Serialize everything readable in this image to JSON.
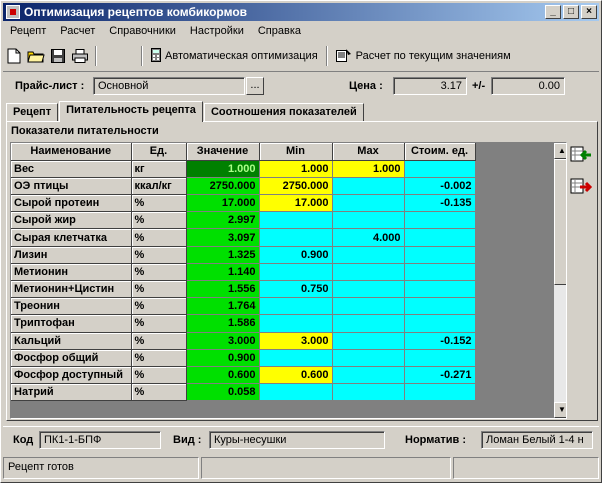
{
  "window": {
    "title": "Оптимизация рецептов комбикормов",
    "controls": {
      "minimize": "_",
      "maximize": "□",
      "close": "×"
    }
  },
  "menu": [
    "Рецепт",
    "Расчет",
    "Справочники",
    "Настройки",
    "Справка"
  ],
  "toolbar": {
    "auto_opt": "Автоматическая оптимизация",
    "calc_current": "Расчет по текущим значениям"
  },
  "price_bar": {
    "price_list_label": "Прайс-лист :",
    "price_list_value": "Основной",
    "browse_label": "...",
    "price_label": "Цена :",
    "price_value": "3.17",
    "plusminus_label": "+/-",
    "plusminus_value": "0.00"
  },
  "tabs": [
    "Рецепт",
    "Питательность рецепта",
    "Соотношения показателей"
  ],
  "active_tab": 1,
  "panel_title": "Показатели питательности",
  "grid": {
    "columns": [
      "Наименование",
      "Ед.",
      "Значение",
      "Min",
      "Max",
      "Стоим. ед."
    ],
    "rows": [
      {
        "name": "Вес",
        "unit": "кг",
        "value": "1.000",
        "min": "1.000",
        "max": "1.000",
        "cost": "",
        "selected": true,
        "min_yellow": true,
        "max_yellow": true
      },
      {
        "name": "ОЭ птицы",
        "unit": "ккал/кг",
        "value": "2750.000",
        "min": "2750.000",
        "max": "",
        "cost": "-0.002",
        "min_yellow": true
      },
      {
        "name": "Сырой протеин",
        "unit": "%",
        "value": "17.000",
        "min": "17.000",
        "max": "",
        "cost": "-0.135",
        "min_yellow": true
      },
      {
        "name": "Сырой жир",
        "unit": "%",
        "value": "2.997",
        "min": "",
        "max": "",
        "cost": ""
      },
      {
        "name": "Сырая клетчатка",
        "unit": "%",
        "value": "3.097",
        "min": "",
        "max": "4.000",
        "cost": ""
      },
      {
        "name": "Лизин",
        "unit": "%",
        "value": "1.325",
        "min": "0.900",
        "max": "",
        "cost": ""
      },
      {
        "name": "Метионин",
        "unit": "%",
        "value": "1.140",
        "min": "",
        "max": "",
        "cost": ""
      },
      {
        "name": "Метионин+Цистин",
        "unit": "%",
        "value": "1.556",
        "min": "0.750",
        "max": "",
        "cost": ""
      },
      {
        "name": "Треонин",
        "unit": "%",
        "value": "1.764",
        "min": "",
        "max": "",
        "cost": ""
      },
      {
        "name": "Триптофан",
        "unit": "%",
        "value": "1.586",
        "min": "",
        "max": "",
        "cost": ""
      },
      {
        "name": "Кальций",
        "unit": "%",
        "value": "3.000",
        "min": "3.000",
        "max": "",
        "cost": "-0.152",
        "min_yellow": true
      },
      {
        "name": "Фосфор общий",
        "unit": "%",
        "value": "0.900",
        "min": "",
        "max": "",
        "cost": ""
      },
      {
        "name": "Фосфор доступный",
        "unit": "%",
        "value": "0.600",
        "min": "0.600",
        "max": "",
        "cost": "-0.271",
        "min_yellow": true
      },
      {
        "name": "Натрий",
        "unit": "%",
        "value": "0.058",
        "min": "",
        "max": "",
        "cost": ""
      }
    ]
  },
  "bottom": {
    "code_label": "Код",
    "code_value": "ПК1-1-БПФ",
    "kind_label": "Вид :",
    "kind_value": "Куры-несушки",
    "norm_label": "Норматив :",
    "norm_value": "Ломан Белый 1-4 н"
  },
  "status": "Рецепт готов",
  "colors": {
    "value_green": "#00e000",
    "selected_green": "#008000",
    "cyan": "#00ffff",
    "yellow": "#ffff00",
    "title_blue": "#0a246a"
  }
}
